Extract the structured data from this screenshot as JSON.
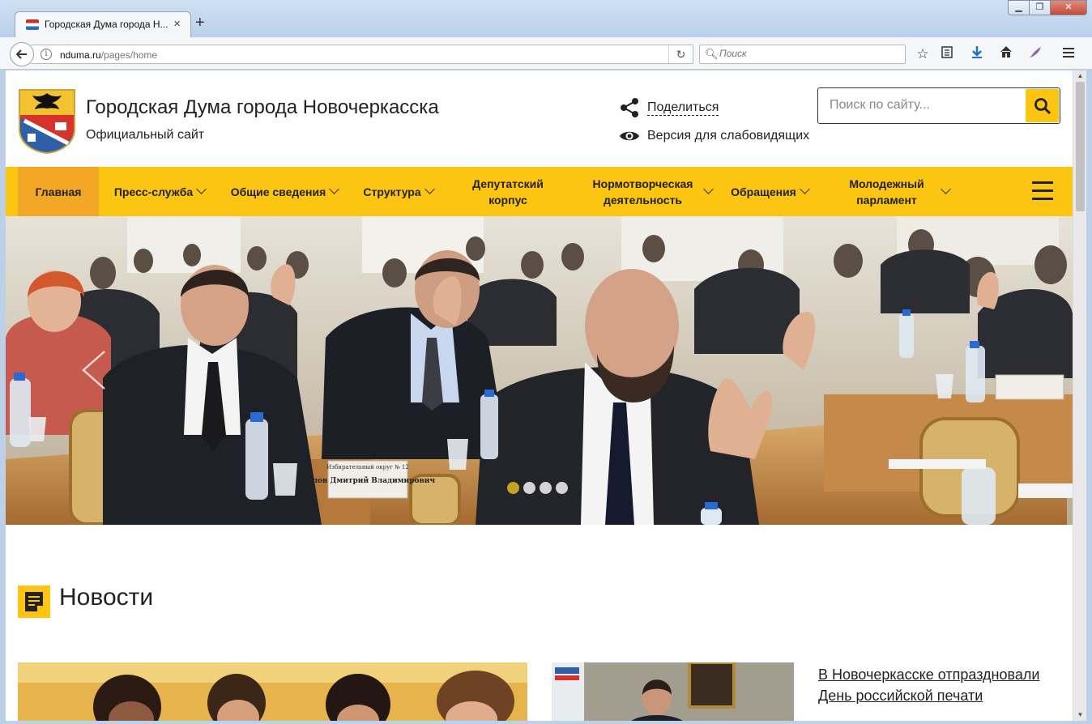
{
  "browser": {
    "tab_title": "Городская Дума города Н...",
    "tab_close": "×",
    "new_tab": "+",
    "url_host": "nduma.ru",
    "url_path": "/pages/home",
    "search_placeholder": "Поиск"
  },
  "header": {
    "site_title": "Городская Дума города Новочеркасска",
    "site_subtitle": "Официальный сайт",
    "share_label": "Поделиться",
    "accessibility_label": "Версия для слабовидящих",
    "search_placeholder": "Поиск по сайту..."
  },
  "nav": {
    "items": [
      {
        "label": "Главная"
      },
      {
        "label": "Пресс-служба"
      },
      {
        "label": "Общие сведения"
      },
      {
        "label": "Структура"
      },
      {
        "label": "Депутатский корпус"
      },
      {
        "label": "Нормотворческая деятельность"
      },
      {
        "label": "Обращения"
      },
      {
        "label": "Молодежный парламент"
      }
    ]
  },
  "slider": {
    "slide_count": 4,
    "active_slide": 1,
    "nameplate_1": "Попов Дмитрий Владимирович",
    "nameplate_1_district": "Избирательный округ № 12"
  },
  "news": {
    "section_title": "Новости",
    "headline_1": "В Новочеркасске отпраздновали День российской печати"
  },
  "colors": {
    "accent_yellow": "#fcc512",
    "nav_active": "#f2a725",
    "dot_active": "#c4a323"
  }
}
